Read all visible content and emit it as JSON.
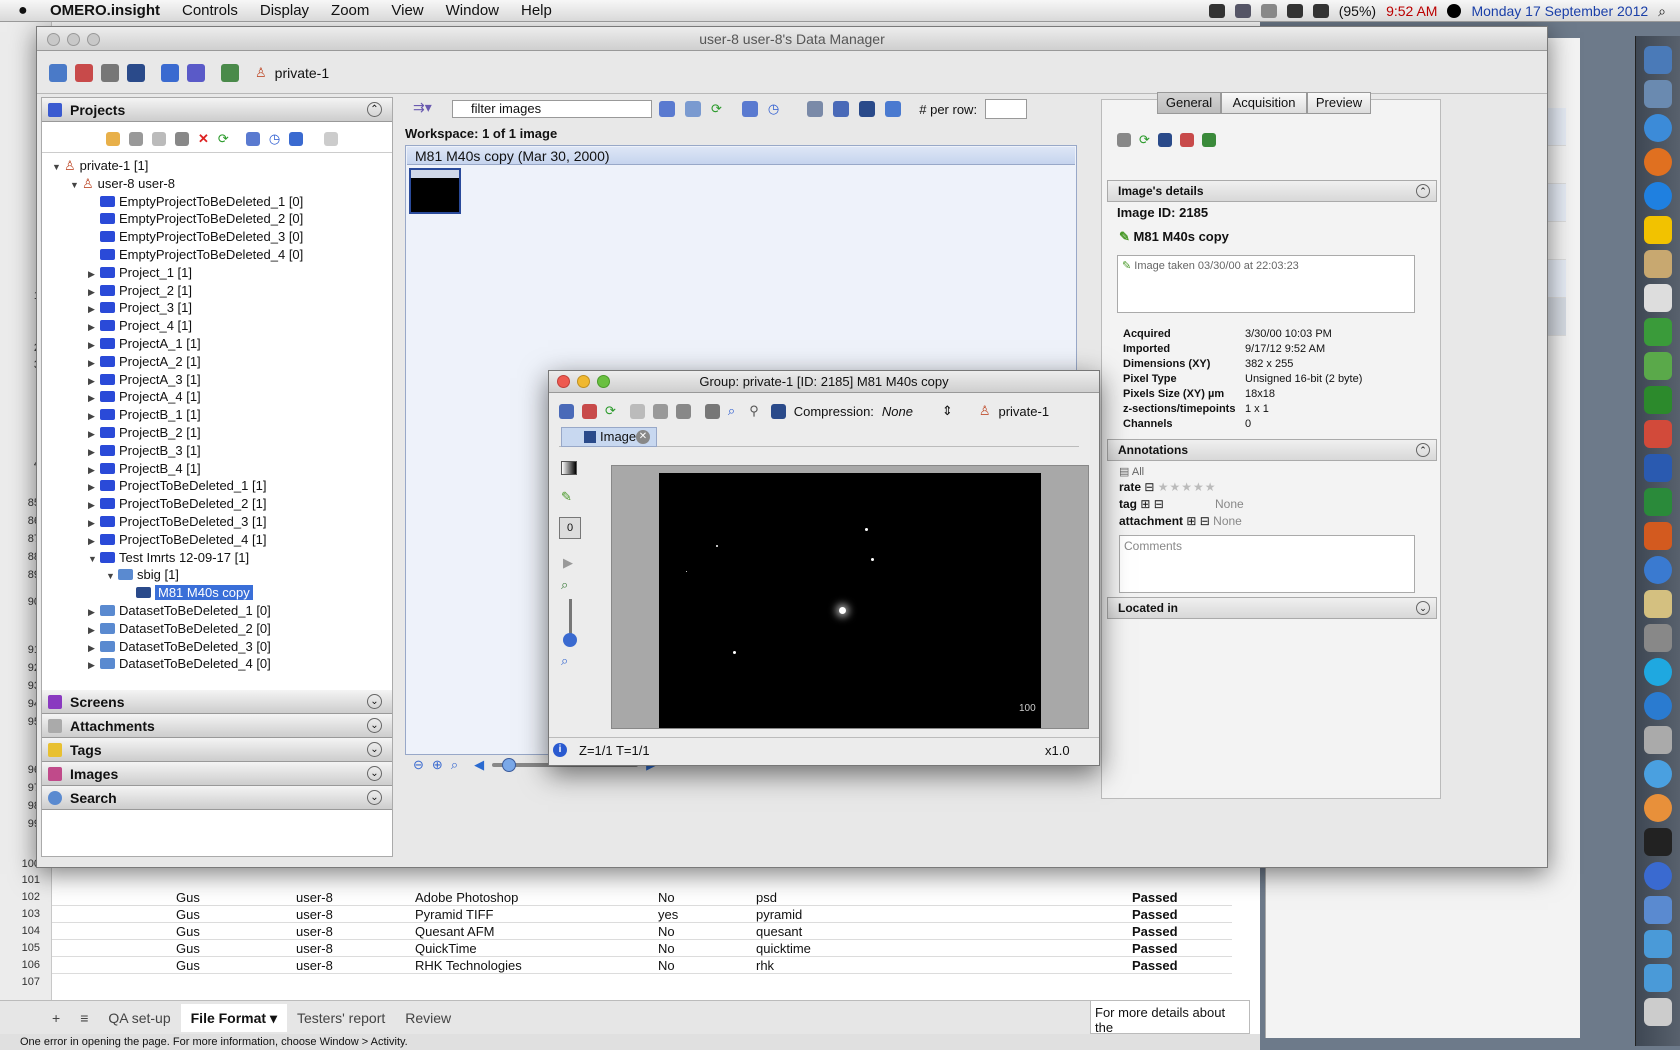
{
  "menubar": {
    "app": "OMERO.insight",
    "items": [
      "Controls",
      "Display",
      "Zoom",
      "View",
      "Window",
      "Help"
    ],
    "battery": "(95%)",
    "time": "9:52 AM",
    "date": "Monday 17 September 2012"
  },
  "sheet": {
    "rownums": [
      "1",
      "2",
      "3",
      "4",
      "85",
      "86",
      "87",
      "88",
      "89",
      "90",
      "91",
      "92",
      "93",
      "94",
      "95",
      "96",
      "97",
      "98",
      "99",
      "100",
      "101",
      "102",
      "103",
      "104",
      "105",
      "106",
      "107"
    ],
    "rows": [
      {
        "num": "101",
        "a": "Gus",
        "b": "user-8",
        "c": "Adobe Photoshop",
        "d": "No",
        "e": "psd",
        "f": "Passed"
      },
      {
        "num": "102",
        "a": "Gus",
        "b": "user-8",
        "c": "Pyramid TIFF",
        "d": "yes",
        "e": "pyramid",
        "f": "Passed"
      },
      {
        "num": "103",
        "a": "Gus",
        "b": "user-8",
        "c": "Quesant AFM",
        "d": "No",
        "e": "quesant",
        "f": "Passed"
      },
      {
        "num": "104",
        "a": "Gus",
        "b": "user-8",
        "c": "QuickTime",
        "d": "No",
        "e": "quicktime",
        "f": "Passed"
      },
      {
        "num": "105",
        "a": "Gus",
        "b": "user-8",
        "c": "RHK Technologies",
        "d": "No",
        "e": "rhk",
        "f": "Passed"
      }
    ],
    "tabs": [
      "+",
      "≡",
      "QA set-up",
      "File Format ▾",
      "Testers' report",
      "Review"
    ],
    "more": "For more details about the",
    "status": "One error in opening the page. For more information, choose Window > Activity."
  },
  "dm": {
    "title": "user-8 user-8's Data Manager",
    "group": "private-1",
    "projects_header": "Projects",
    "tree": [
      {
        "label": "private-1 [1]",
        "indent": 0,
        "tri": "▼",
        "kind": "group"
      },
      {
        "label": "user-8 user-8",
        "indent": 1,
        "tri": "▼",
        "kind": "user"
      },
      {
        "label": "EmptyProjectToBeDeleted_1 [0]",
        "indent": 2,
        "tri": "",
        "kind": "project"
      },
      {
        "label": "EmptyProjectToBeDeleted_2 [0]",
        "indent": 2,
        "tri": "",
        "kind": "project"
      },
      {
        "label": "EmptyProjectToBeDeleted_3 [0]",
        "indent": 2,
        "tri": "",
        "kind": "project"
      },
      {
        "label": "EmptyProjectToBeDeleted_4 [0]",
        "indent": 2,
        "tri": "",
        "kind": "project"
      },
      {
        "label": "Project_1 [1]",
        "indent": 2,
        "tri": "▶",
        "kind": "project"
      },
      {
        "label": "Project_2 [1]",
        "indent": 2,
        "tri": "▶",
        "kind": "project"
      },
      {
        "label": "Project_3 [1]",
        "indent": 2,
        "tri": "▶",
        "kind": "project"
      },
      {
        "label": "Project_4 [1]",
        "indent": 2,
        "tri": "▶",
        "kind": "project"
      },
      {
        "label": "ProjectA_1 [1]",
        "indent": 2,
        "tri": "▶",
        "kind": "project"
      },
      {
        "label": "ProjectA_2 [1]",
        "indent": 2,
        "tri": "▶",
        "kind": "project"
      },
      {
        "label": "ProjectA_3 [1]",
        "indent": 2,
        "tri": "▶",
        "kind": "project"
      },
      {
        "label": "ProjectA_4 [1]",
        "indent": 2,
        "tri": "▶",
        "kind": "project"
      },
      {
        "label": "ProjectB_1 [1]",
        "indent": 2,
        "tri": "▶",
        "kind": "project"
      },
      {
        "label": "ProjectB_2 [1]",
        "indent": 2,
        "tri": "▶",
        "kind": "project"
      },
      {
        "label": "ProjectB_3 [1]",
        "indent": 2,
        "tri": "▶",
        "kind": "project"
      },
      {
        "label": "ProjectB_4 [1]",
        "indent": 2,
        "tri": "▶",
        "kind": "project"
      },
      {
        "label": "ProjectToBeDeleted_1 [1]",
        "indent": 2,
        "tri": "▶",
        "kind": "project"
      },
      {
        "label": "ProjectToBeDeleted_2 [1]",
        "indent": 2,
        "tri": "▶",
        "kind": "project"
      },
      {
        "label": "ProjectToBeDeleted_3 [1]",
        "indent": 2,
        "tri": "▶",
        "kind": "project"
      },
      {
        "label": "ProjectToBeDeleted_4 [1]",
        "indent": 2,
        "tri": "▶",
        "kind": "project"
      },
      {
        "label": "Test Imrts 12-09-17 [1]",
        "indent": 2,
        "tri": "▼",
        "kind": "project"
      },
      {
        "label": "sbig [1]",
        "indent": 3,
        "tri": "▼",
        "kind": "dataset"
      },
      {
        "label": "M81 M40s copy",
        "indent": 4,
        "tri": "",
        "kind": "image",
        "selected": true
      },
      {
        "label": "DatasetToBeDeleted_1 [0]",
        "indent": 2,
        "tri": "▶",
        "kind": "dataset"
      },
      {
        "label": "DatasetToBeDeleted_2 [0]",
        "indent": 2,
        "tri": "▶",
        "kind": "dataset"
      },
      {
        "label": "DatasetToBeDeleted_3 [0]",
        "indent": 2,
        "tri": "▶",
        "kind": "dataset"
      },
      {
        "label": "DatasetToBeDeleted_4 [0]",
        "indent": 2,
        "tri": "▶",
        "kind": "dataset"
      }
    ],
    "sections": [
      "Screens",
      "Attachments",
      "Tags",
      "Images",
      "Search"
    ],
    "filter_placeholder": "filter  images",
    "per_row_label": "# per row:",
    "workspace_label": "Workspace: 1 of 1 image",
    "image_title": "M81 M40s copy (Mar 30, 2000)"
  },
  "meta": {
    "tabs": [
      "General",
      "Acquisition",
      "Preview"
    ],
    "details_header": "Image's details",
    "image_id": "Image ID: 2185",
    "name": "M81 M40s copy",
    "description": "Image taken 03/30/00 at 22:03:23",
    "fields": [
      {
        "k": "Acquired",
        "v": "3/30/00 10:03 PM"
      },
      {
        "k": "Imported",
        "v": "9/17/12 9:52 AM"
      },
      {
        "k": "Dimensions (XY)",
        "v": "382 x 255"
      },
      {
        "k": "Pixel Type",
        "v": "Unsigned 16-bit (2 byte)"
      },
      {
        "k": "Pixels Size (XY) µm",
        "v": "18x18"
      },
      {
        "k": "z-sections/timepoints",
        "v": "1 x 1"
      },
      {
        "k": "Channels",
        "v": "0"
      }
    ],
    "annotations_header": "Annotations",
    "all": "All",
    "rate": "rate",
    "rating": 0,
    "tag": "tag",
    "tag_value": "None",
    "attachment": "attachment",
    "attachment_value": "None",
    "comments_placeholder": "Comments",
    "located_in": "Located in"
  },
  "viewer": {
    "title": "Group: private-1 [ID: 2185] M81 M40s copy",
    "compression_label": "Compression:",
    "compression_value": "None",
    "group": "private-1",
    "tab": "Image",
    "channel_value": "0",
    "scale_label": "100",
    "status": "Z=1/1 T=1/1",
    "zoom": "x1.0"
  }
}
